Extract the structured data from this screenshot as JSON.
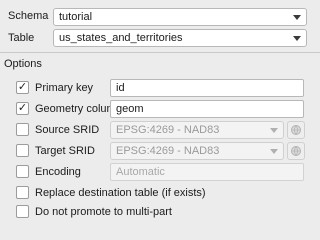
{
  "schema": {
    "label": "Schema",
    "value": "tutorial"
  },
  "table": {
    "label": "Table",
    "value": "us_states_and_territories"
  },
  "options": {
    "heading": "Options",
    "primary_key": {
      "label": "Primary key",
      "checked": true,
      "value": "id"
    },
    "geometry_column": {
      "label": "Geometry column",
      "checked": true,
      "value": "geom"
    },
    "source_srid": {
      "label": "Source SRID",
      "checked": false,
      "value": "EPSG:4269 - NAD83"
    },
    "target_srid": {
      "label": "Target SRID",
      "checked": false,
      "value": "EPSG:4269 - NAD83"
    },
    "encoding": {
      "label": "Encoding",
      "checked": false,
      "placeholder": "Automatic"
    },
    "replace_table": {
      "label": "Replace destination table (if exists)",
      "checked": false
    },
    "no_promote": {
      "label": "Do not promote to multi-part",
      "checked": false
    }
  },
  "icons": {
    "checkmark": "✓",
    "crs_selector": "globe-icon"
  }
}
